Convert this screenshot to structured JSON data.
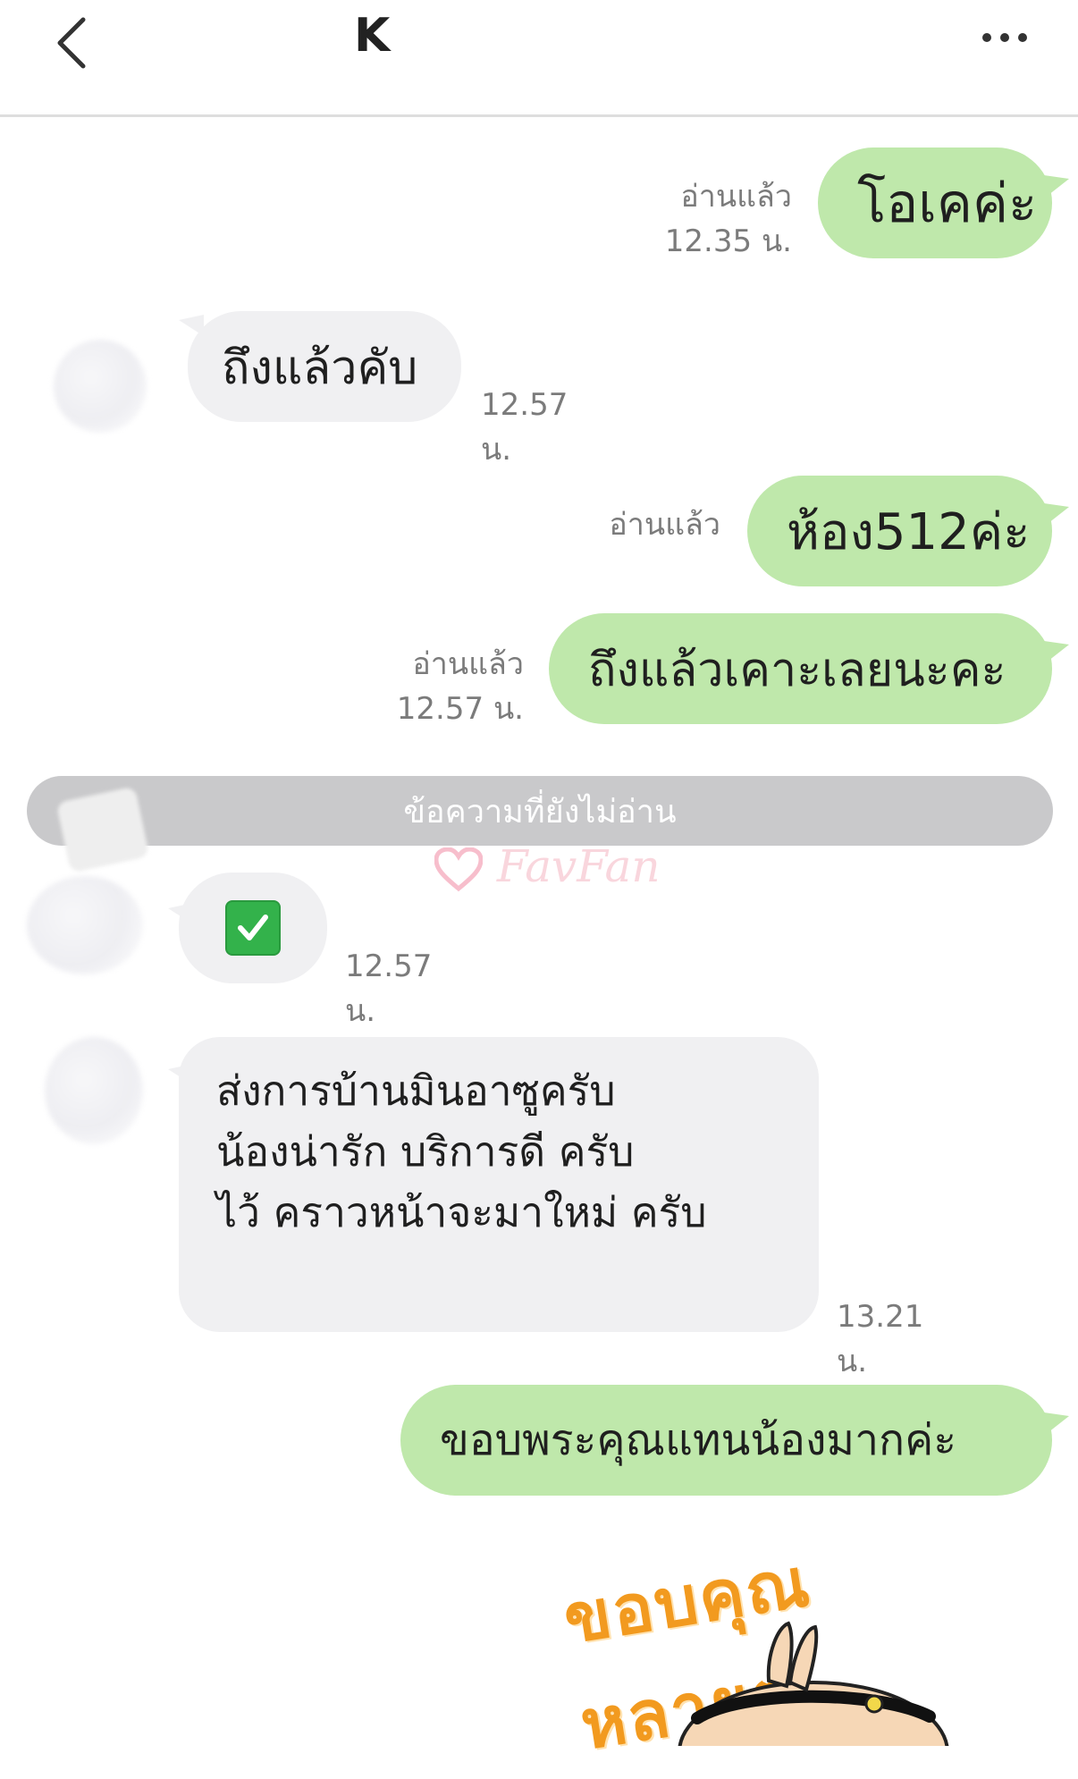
{
  "header": {
    "title": "K",
    "back_icon": "chevron-left-icon",
    "more_icon": "more-horizontal-icon"
  },
  "messages": [
    {
      "id": "m1",
      "side": "out",
      "text": "โอเคค่ะ",
      "read": "อ่านแล้ว",
      "time": "12.35 น."
    },
    {
      "id": "m2",
      "side": "in",
      "text": "ถึงแล้วคับ",
      "time": "12.57 น."
    },
    {
      "id": "m3",
      "side": "out",
      "text": "ห้อง512ค่ะ",
      "read": "อ่านแล้ว",
      "time": ""
    },
    {
      "id": "m4",
      "side": "out",
      "text": "ถึงแล้วเคาะเลยนะคะ",
      "read": "อ่านแล้ว",
      "time": "12.57 น."
    },
    {
      "id": "m5",
      "side": "in",
      "emoji": "white-heavy-check-mark-icon",
      "time": "12.57 น."
    },
    {
      "id": "m6",
      "side": "in",
      "lines": [
        "ส่งการบ้านมินอาซูครับ",
        "น้องน่ารัก บริการดี ครับ",
        "ไว้ คราวหน้าจะมาใหม่ ครับ"
      ],
      "time": "13.21 น."
    },
    {
      "id": "m7",
      "side": "out",
      "text": "ขอบพระคุณแทนน้องมากค่ะ"
    }
  ],
  "divider": {
    "label": "ข้อความที่ยังไม่อ่าน"
  },
  "watermark": {
    "text": "FavFan"
  },
  "sticker": {
    "text": "ขอบคุณหลายๆ"
  },
  "colors": {
    "bubble_out": "#bfe8ab",
    "bubble_in": "#f0f0f2",
    "divider": "#c9c9cb",
    "sticker": "#f29a1f"
  }
}
